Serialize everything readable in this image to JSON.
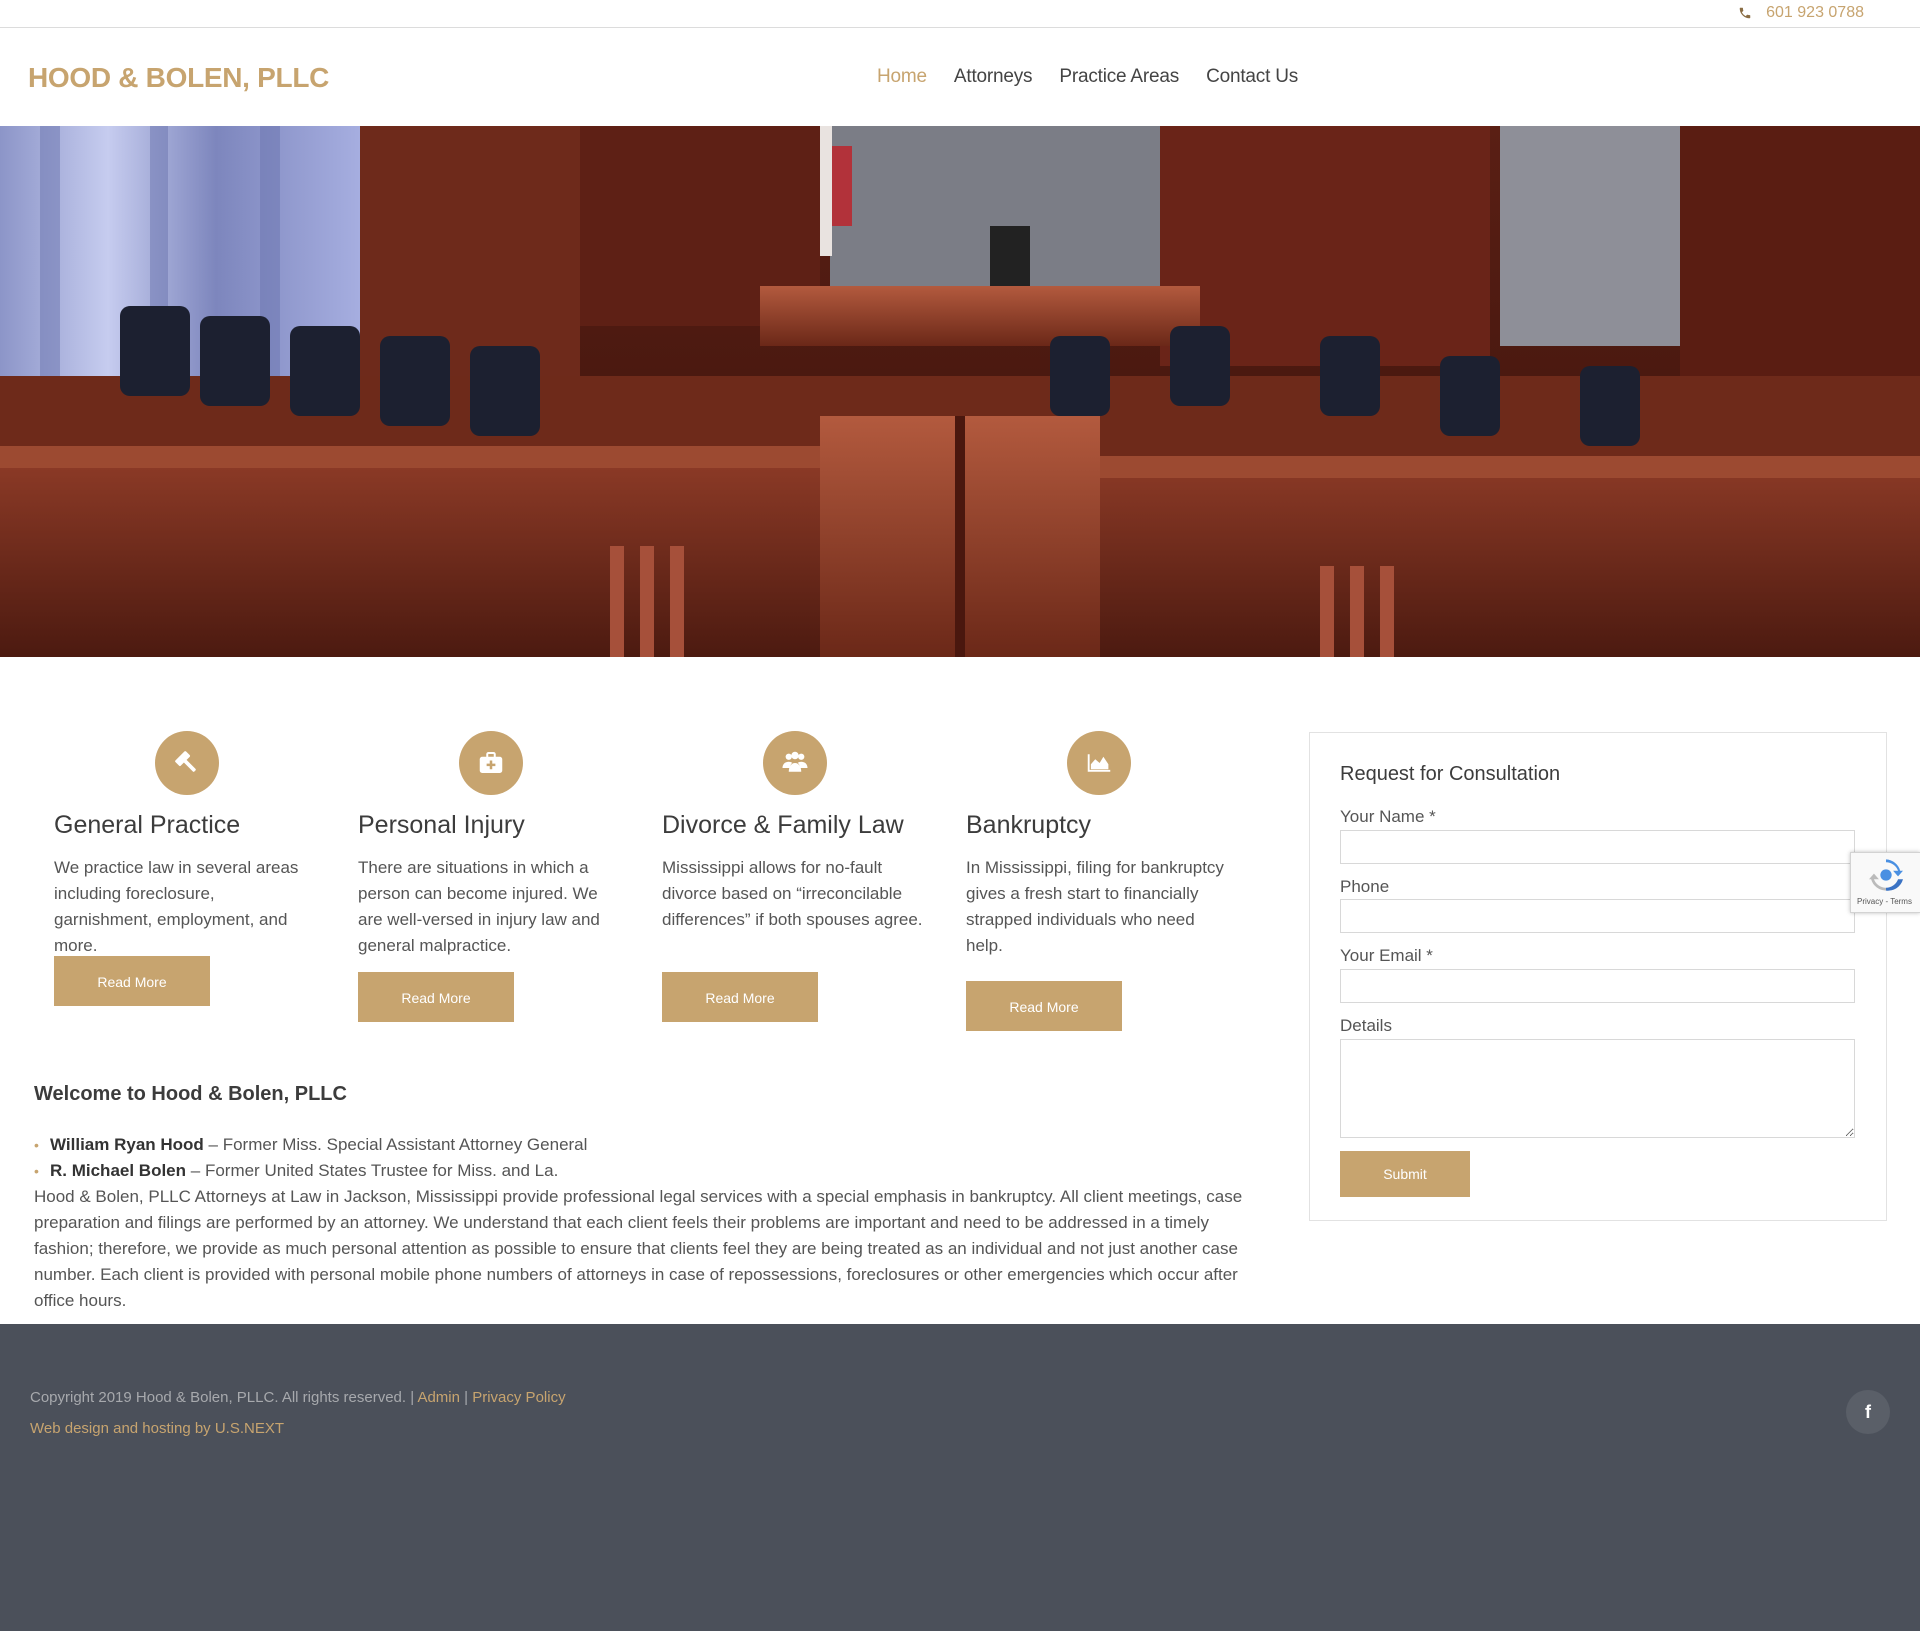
{
  "topbar": {
    "phone": "601 923 0788"
  },
  "header": {
    "logo": "HOOD & BOLEN, PLLC",
    "nav": [
      {
        "label": "Home",
        "active": true
      },
      {
        "label": "Attorneys"
      },
      {
        "label": "Practice Areas"
      },
      {
        "label": "Contact Us"
      }
    ]
  },
  "features": [
    {
      "title": "General Practice",
      "icon": "gavel-icon",
      "text": "We practice law in several areas including foreclosure, garnishment, employment, and more.",
      "button": "Read More"
    },
    {
      "title": "Personal Injury",
      "icon": "medkit-icon",
      "text": "There are situations in which a person can become injured. We are well-versed in injury law and general malpractice.",
      "button": "Read More"
    },
    {
      "title": "Divorce & Family Law",
      "icon": "users-icon",
      "text": "Mississippi allows for no-fault divorce based on “irreconcilable differences” if both spouses agree.",
      "button": "Read More"
    },
    {
      "title": "Bankruptcy",
      "icon": "area-chart-icon",
      "text": "In Mississippi, filing for bankruptcy gives a fresh start to financially strapped individuals who need help.",
      "button": "Read More"
    }
  ],
  "welcome": {
    "title": "Welcome to Hood & Bolen, PLLC",
    "attorneys": [
      {
        "name": "William Ryan Hood",
        "role": "Former Miss. Special Assistant Attorney General"
      },
      {
        "name": "R. Michael Bolen",
        "role": "Former United States Trustee for Miss. and La."
      }
    ],
    "separator": " – ",
    "body": "Hood & Bolen, PLLC Attorneys at Law in Jackson, Mississippi provide professional legal services with a special emphasis in bankruptcy. All client meetings, case preparation and filings are performed by an attorney. We understand that each client feels their problems are important and need to be addressed in a timely fashion; therefore, we provide as much personal attention as possible to ensure that clients feel they are being treated as an individual and not just another case number. Each client is provided with personal mobile phone numbers of attorneys in case of repossessions, foreclosures or other emergencies which occur after office hours."
  },
  "form": {
    "title": "Request for Consultation",
    "name_label": "Your Name *",
    "phone_label": "Phone",
    "email_label": "Your Email *",
    "details_label": "Details",
    "submit": "Submit"
  },
  "recaptcha": {
    "text": "Privacy - Terms"
  },
  "footer": {
    "copyright": "Copyright 2019 Hood & Bolen, PLLC. All rights reserved. | ",
    "admin": "Admin",
    "sep": " | ",
    "privacy": "Privacy Policy",
    "credit": "Web design and hosting by U.S.NEXT",
    "facebook": "f"
  },
  "colors": {
    "accent": "#c7a46f",
    "footer": "#4b505a",
    "text": "#555555"
  }
}
